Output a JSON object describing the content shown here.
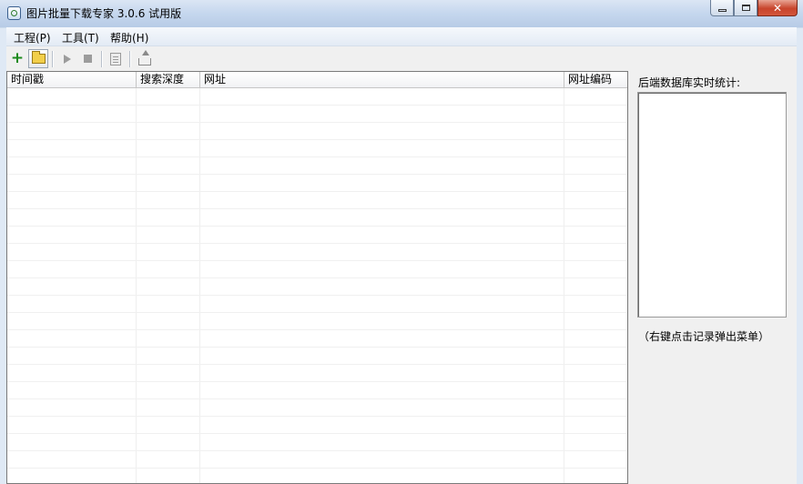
{
  "window": {
    "title": "图片批量下载专家 3.0.6 试用版"
  },
  "menubar": {
    "items": [
      {
        "label": "工程(P)"
      },
      {
        "label": "工具(T)"
      },
      {
        "label": "帮助(H)"
      }
    ]
  },
  "toolbar": {
    "new_icon": "plus-icon",
    "open_icon": "folder-open-icon",
    "start_icon": "play-icon",
    "stop_icon": "stop-icon",
    "properties_icon": "document-icon",
    "export_icon": "export-icon"
  },
  "listview": {
    "columns": [
      {
        "label": "时间戳"
      },
      {
        "label": "搜索深度"
      },
      {
        "label": "网址"
      },
      {
        "label": "网址编码"
      }
    ]
  },
  "sidebar": {
    "stats_label": "后端数据库实时统计:",
    "hint": "（右键点击记录弹出菜单）"
  },
  "colors": {
    "title_bar": "#c5d7ee",
    "close_button": "#c8442c",
    "add_icon": "#1d8a1d",
    "folder_icon": "#f2cf4a"
  }
}
